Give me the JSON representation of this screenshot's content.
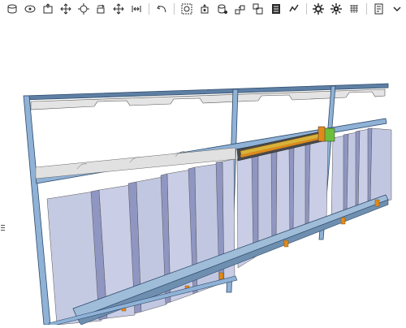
{
  "toolbar": {
    "tools": [
      {
        "name": "display-style-icon"
      },
      {
        "name": "view-orientation-icon"
      },
      {
        "name": "section-view-icon"
      },
      {
        "name": "pan-icon"
      },
      {
        "name": "zoom-fit-icon"
      },
      {
        "name": "rotate-icon"
      },
      {
        "name": "move-icon"
      },
      {
        "name": "mirror-icon"
      },
      {
        "name": "undo-icon"
      },
      {
        "name": "zoom-area-icon"
      },
      {
        "name": "appearance-icon"
      },
      {
        "name": "mass-properties-icon"
      },
      {
        "name": "exploded-view-icon"
      },
      {
        "name": "assembly-icon"
      },
      {
        "name": "bill-of-materials-icon"
      },
      {
        "name": "settings-gear-icon"
      },
      {
        "name": "options-gear-icon"
      },
      {
        "name": "simulation-icon"
      },
      {
        "name": "document-icon"
      },
      {
        "name": "dropdown-chevron-icon"
      }
    ],
    "icon_color": "#2b2b2b"
  },
  "viewport": {
    "model_description_colors": {
      "frame": "#7fa3c7",
      "panel_light": "#c9cde3",
      "panel_mid": "#aab0d2",
      "panel_dark": "#8f96c2",
      "top_plate": "#e4e4e4",
      "accent_orange": "#e08a1a",
      "accent_yellow": "#d9b23a",
      "accent_green": "#6bbf3a"
    }
  }
}
